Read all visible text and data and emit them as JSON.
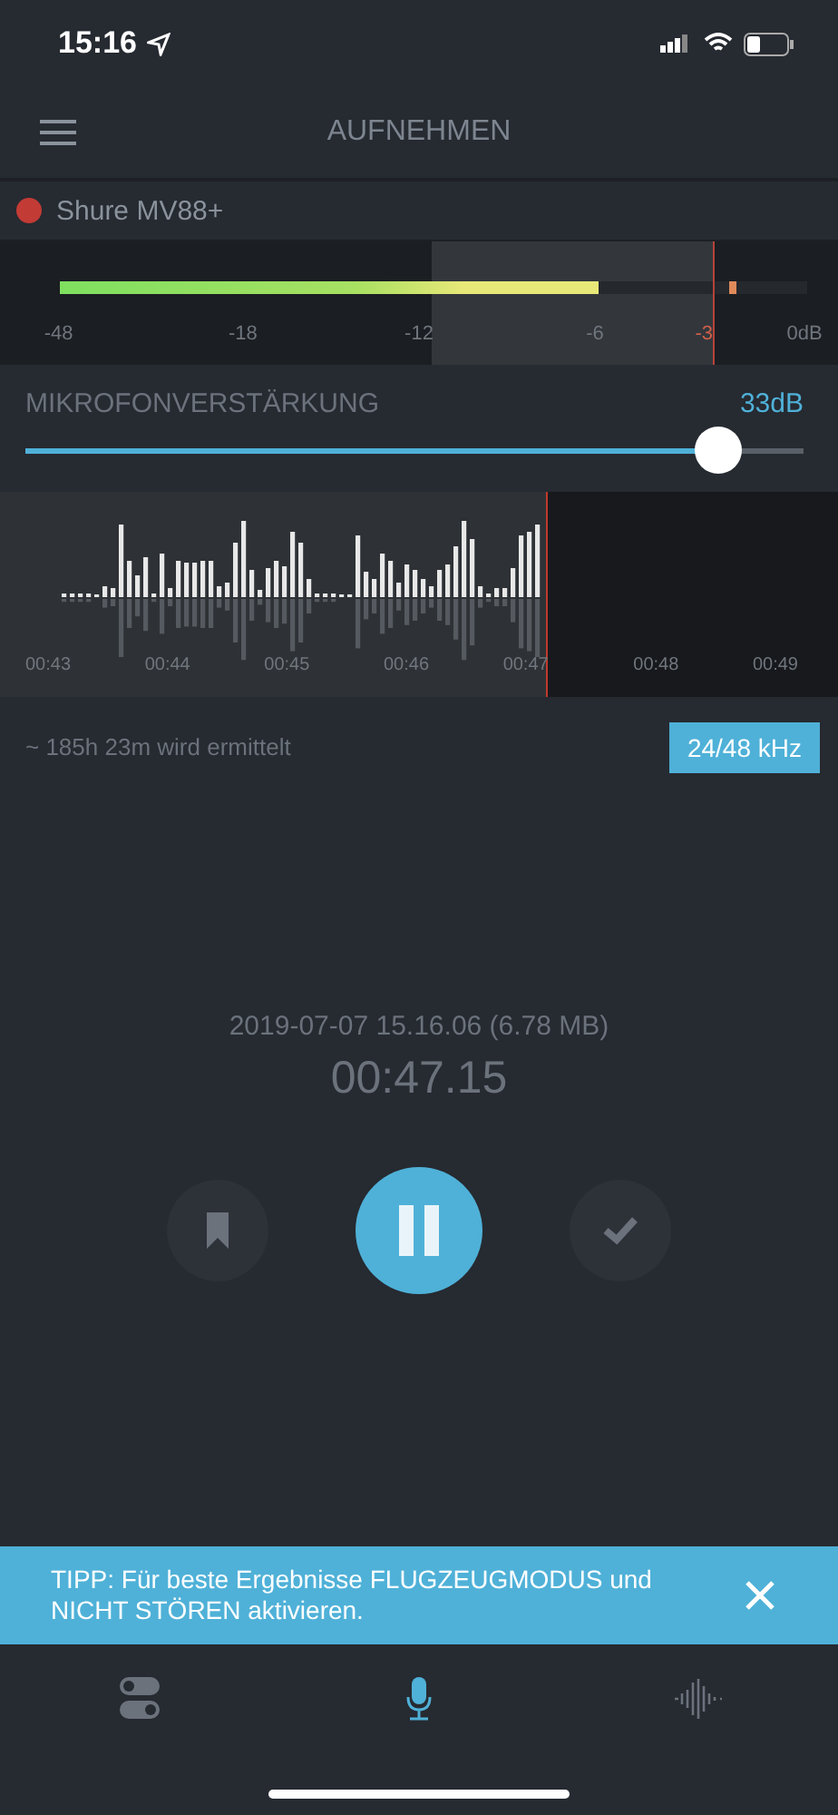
{
  "status_bar": {
    "time": "15:16"
  },
  "header": {
    "title": "AUFNEHMEN"
  },
  "device": {
    "name": "Shure MV88+",
    "recording": true
  },
  "meter": {
    "level": 0.72,
    "scale": [
      "-48",
      "-18",
      "-12",
      "-6",
      "-3",
      "0dB"
    ]
  },
  "gain": {
    "label": "MIKROFONVERSTÄRKUNG",
    "reading": "33dB",
    "level": 0.89
  },
  "waveform": {
    "times": [
      "00:43",
      "00:44",
      "00:45",
      "00:46",
      "00:47",
      "00:48",
      "00:49"
    ]
  },
  "info": {
    "remaining": "~ 185h 23m wird ermittelt",
    "format": "24/48 kHz"
  },
  "recording": {
    "file": "2019-07-07 15.16.06 (6.78 MB)",
    "elapsed": "00:47.15"
  },
  "controls": [
    {
      "kind": "bookmark"
    },
    {
      "kind": "pause"
    },
    {
      "kind": "done"
    }
  ],
  "tip": {
    "text": "TIPP: Für beste Ergebnisse FLUGZEUGMODUS und NICHT STÖREN aktivieren."
  },
  "tabs": [
    {
      "kind": "settings",
      "selected": false
    },
    {
      "kind": "record",
      "selected": true
    },
    {
      "kind": "recordings",
      "selected": false
    }
  ]
}
